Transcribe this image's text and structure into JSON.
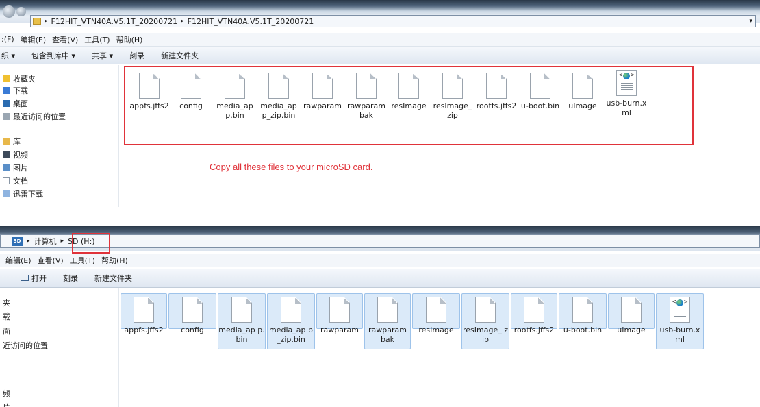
{
  "top": {
    "breadcrumb": [
      "F12HIT_VTN40A.V5.1T_20200721",
      "F12HIT_VTN40A.V5.1T_20200721"
    ],
    "menu": [
      ":(F)",
      "编辑(E)",
      "查看(V)",
      "工具(T)",
      "帮助(H)"
    ],
    "toolbar": [
      "织 ▾",
      "包含到库中 ▾",
      "共享 ▾",
      "刻录",
      "新建文件夹"
    ],
    "nav": [
      "收藏夹",
      "下载",
      "桌面",
      "最近访问的位置",
      "库",
      "视频",
      "图片",
      "文档",
      "迅雷下载"
    ],
    "files": [
      "appfs.jffs2",
      "config",
      "media_ap p.bin",
      "media_ap p_zip.bin",
      "rawparam",
      "rawparam bak",
      "resImage",
      "resImage_ zip",
      "rootfs.jffs2",
      "u-boot.bin",
      "uImage",
      "usb-burn.x ml"
    ],
    "note": "Copy all these files to your microSD card."
  },
  "bottom": {
    "breadcrumb": [
      "计算机",
      "SD (H:)"
    ],
    "drive_badge": "SD",
    "menu": [
      "编辑(E)",
      "查看(V)",
      "工具(T)",
      "帮助(H)"
    ],
    "toolbar": [
      "打开",
      "刻录",
      "新建文件夹"
    ],
    "nav": [
      "夹",
      "载",
      "面",
      "近访问的位置",
      "频",
      "片"
    ],
    "files": [
      "appfs.jffs2",
      "config",
      "media_ap p.bin",
      "media_ap p_zip.bin",
      "rawparam",
      "rawparam bak",
      "resImage",
      "resImage_ zip",
      "rootfs.jffs2",
      "u-boot.bin",
      "uImage",
      "usb-burn.x ml"
    ]
  },
  "colors": {
    "highlight": "#e0333a",
    "selection": "#dbeaf9"
  }
}
